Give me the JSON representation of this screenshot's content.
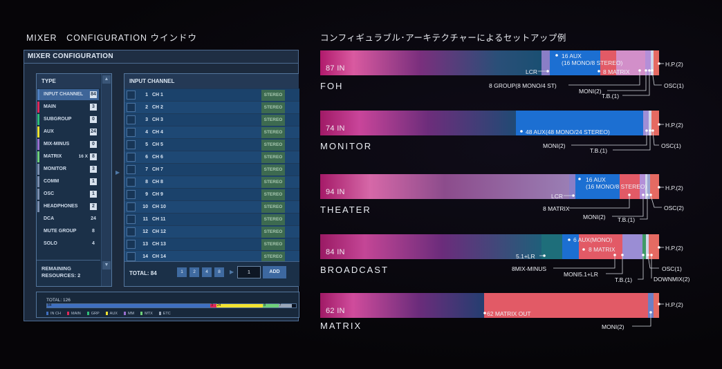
{
  "headings": {
    "left": "MIXER　CONFIGURATION ウインドウ",
    "right": "コンフィギュラブル･アーキテクチャーによるセットアップ例"
  },
  "mixer": {
    "title": "MIXER CONFIGURATION",
    "type_header": "TYPE",
    "types": [
      {
        "label": "INPUT CHANNEL",
        "count": "84",
        "color": "#4f7fc0",
        "selected": true
      },
      {
        "label": "MAIN",
        "count": "3",
        "color": "#e0285a"
      },
      {
        "label": "SUBGROUP",
        "count": "0",
        "color": "#2fbf7a"
      },
      {
        "label": "AUX",
        "count": "24",
        "color": "#f2e231"
      },
      {
        "label": "MIX-MINUS",
        "count": "0",
        "color": "#9a6fd0"
      },
      {
        "label": "MATRIX",
        "prefix": "16 X",
        "count": "8",
        "color": "#6fd07a"
      },
      {
        "label": "MONITOR",
        "count": "3",
        "color": "#7c8fb0"
      },
      {
        "label": "COMM",
        "count": "1",
        "color": "#7c8fb0"
      },
      {
        "label": "OSC",
        "count": "1",
        "color": "#7c8fb0"
      },
      {
        "label": "HEADPHONES",
        "count": "2",
        "color": "#7c8fb0"
      },
      {
        "label": "DCA",
        "count": "24",
        "plain": true
      },
      {
        "label": "MUTE GROUP",
        "count": "8",
        "plain": true
      },
      {
        "label": "SOLO",
        "count": "4",
        "plain": true
      }
    ],
    "remaining": "REMAINING RESOURCES: 2",
    "channel_header": "INPUT CHANNEL",
    "channels": [
      {
        "num": "1",
        "name": "CH 1",
        "mode": "STEREO"
      },
      {
        "num": "2",
        "name": "CH 2",
        "mode": "STEREO"
      },
      {
        "num": "3",
        "name": "CH 3",
        "mode": "STEREO"
      },
      {
        "num": "4",
        "name": "CH 4",
        "mode": "STEREO"
      },
      {
        "num": "5",
        "name": "CH 5",
        "mode": "STEREO"
      },
      {
        "num": "6",
        "name": "CH 6",
        "mode": "STEREO"
      },
      {
        "num": "7",
        "name": "CH 7",
        "mode": "STEREO"
      },
      {
        "num": "8",
        "name": "CH 8",
        "mode": "STEREO"
      },
      {
        "num": "9",
        "name": "CH 9",
        "mode": "STEREO"
      },
      {
        "num": "10",
        "name": "CH 10",
        "mode": "STEREO"
      },
      {
        "num": "11",
        "name": "CH 11",
        "mode": "STEREO"
      },
      {
        "num": "12",
        "name": "CH 12",
        "mode": "STEREO"
      },
      {
        "num": "13",
        "name": "CH 13",
        "mode": "STEREO"
      },
      {
        "num": "14",
        "name": "CH 14",
        "mode": "STEREO"
      }
    ],
    "total": "TOTAL: 84",
    "pages": [
      "1",
      "2",
      "4",
      "8"
    ],
    "count_value": "1",
    "add_label": "ADD",
    "resources": {
      "total": "TOTAL: 126",
      "segments": [
        {
          "label": "84",
          "value": 84,
          "color": "#3f6fc0"
        },
        {
          "label": "3",
          "value": 3,
          "color": "#e0285a"
        },
        {
          "label": "24",
          "value": 24,
          "color": "#f2e231"
        },
        {
          "label": "8",
          "value": 8,
          "color": "#6fd07a"
        },
        {
          "label": "7",
          "value": 7,
          "color": "#9aa6b8"
        }
      ],
      "legend": [
        {
          "label": "IN CH",
          "color": "#3f6fc0"
        },
        {
          "label": "MAIN",
          "color": "#e0285a"
        },
        {
          "label": "GRP",
          "color": "#2fbf7a"
        },
        {
          "label": "AUX",
          "color": "#f2e231"
        },
        {
          "label": "MM",
          "color": "#9a6fd0"
        },
        {
          "label": "MTX",
          "color": "#6fd07a"
        },
        {
          "label": "ETC",
          "color": "#9aa6b8"
        }
      ]
    }
  },
  "configs": [
    {
      "name": "FOH",
      "in_label": "87 IN",
      "annotations": [
        "16 AUX\n(16 MONO/8 STEREO)",
        "LCR",
        "8 MATRIX",
        "8 GROUP(8 MONO/4 ST)",
        "MONI(2)",
        "T.B.(1)",
        "OSC(1)",
        "H.P.(2)"
      ]
    },
    {
      "name": "MONITOR",
      "in_label": "74 IN",
      "annotations": [
        "48 AUX(48 MONO/24 STEREO)",
        "MONI(2)",
        "T.B.(1)",
        "OSC(1)",
        "H.P.(2)"
      ]
    },
    {
      "name": "THEATER",
      "in_label": "94 IN",
      "annotations": [
        "16 AUX\n(16 MONO/8 STEREO)",
        "LCR",
        "8 MATRIX",
        "MONI(2)",
        "T.B.(1)",
        "OSC(2)",
        "H.P.(2)"
      ]
    },
    {
      "name": "BROADCAST",
      "in_label": "84 IN",
      "annotations": [
        "6 AUX(MONO)",
        "8 MATRIX",
        "5.1+LR",
        "8MIX-MINUS",
        "MONI5.1+LR",
        "T.B.(1)",
        "OSC(1)",
        "DOWNMIX(2)",
        "H.P.(2)"
      ]
    },
    {
      "name": "MATRIX",
      "in_label": "62 IN",
      "annotations": [
        "62 MATRIX OUT",
        "MONI(2)",
        "H.P.(2)"
      ]
    }
  ]
}
